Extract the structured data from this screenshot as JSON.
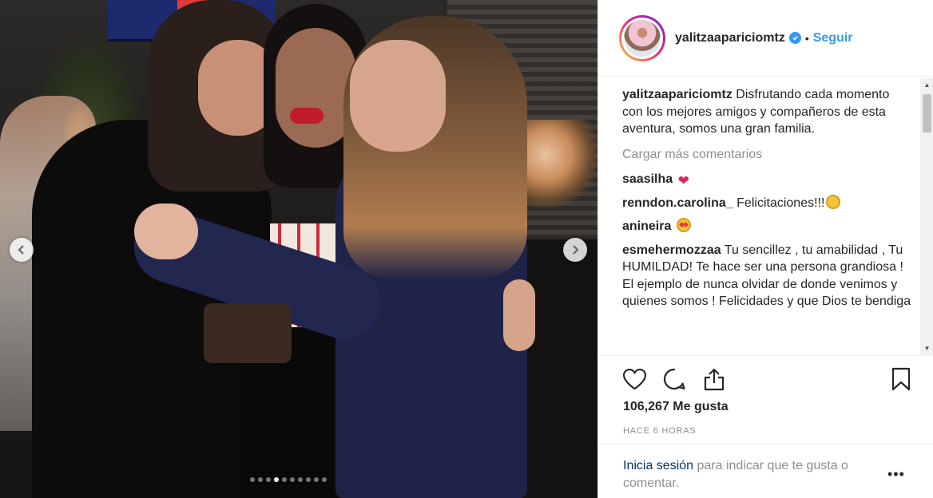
{
  "photo": {
    "carousel": {
      "total_dots": 10,
      "active_index": 3
    },
    "prev_icon": "chevron-left-icon",
    "next_icon": "chevron-right-icon"
  },
  "header": {
    "username": "yalitzaapariciomtz",
    "verified_icon": "verified-badge-icon",
    "separator": "•",
    "follow_label": "Seguir"
  },
  "caption": {
    "username": "yalitzaapariciomtz",
    "text": "Disfrutando cada momento con los mejores amigos y compañeros de esta aventura, somos una gran familia."
  },
  "load_more_label": "Cargar más comentarios",
  "comments": [
    {
      "username": "saasilha",
      "text": "",
      "emoji": "heart"
    },
    {
      "username": "renndon.carolina_",
      "text": "Felicitaciones!!!",
      "emoji": "grin"
    },
    {
      "username": "anineira",
      "text": "",
      "emoji": "starstruck"
    },
    {
      "username": "esmehermozzaa",
      "text": "Tu sencillez , tu amabilidad , Tu HUMILDAD! Te hace ser una persona grandiosa ! El ejemplo de nunca olvidar de donde venimos y quienes somos ! Felicidades y que Dios te bendiga",
      "emoji": ""
    }
  ],
  "actions": {
    "like_icon": "heart-outline-icon",
    "comment_icon": "comment-icon",
    "share_icon": "share-icon",
    "save_icon": "bookmark-icon"
  },
  "likes_text": "106,267 Me gusta",
  "time_text": "HACE 6 HORAS",
  "login": {
    "link_text": "Inicia sesión",
    "rest_text": " para indicar que te gusta o comentar."
  },
  "more_label": "•••",
  "colors": {
    "link_blue": "#3897f0",
    "text": "#262626",
    "muted": "#8e8e8e",
    "verified": "#3897f0"
  }
}
